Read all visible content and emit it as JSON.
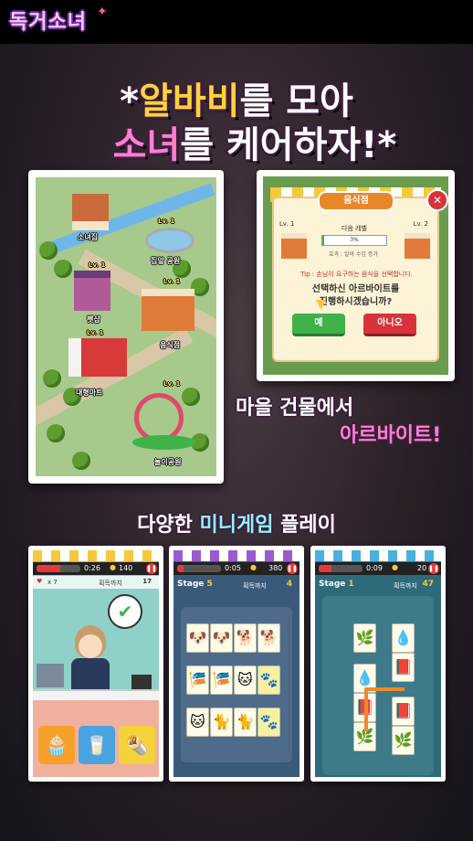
{
  "app": {
    "logo": "독거소녀"
  },
  "headline": {
    "line1_prefix": "*",
    "line1_highlight": "알바비",
    "line1_rest": "를 모아",
    "line2_highlight": "소녀",
    "line2_rest": "를 케어하자!*"
  },
  "map": {
    "labels": {
      "house": "소녀집",
      "park": "집앞 공원",
      "petshop": "펫샵",
      "restaurant": "음식점",
      "mart": "대형마트",
      "amusement": "놀이공원"
    },
    "level": "Lv. 1"
  },
  "shop_dialog": {
    "title": "음식점",
    "lv_left": "Lv. 1",
    "lv_right": "Lv. 2",
    "next_level_label": "다음 레벨",
    "progress_text": "3%",
    "progress_value": 0.03,
    "effect_text": "효과 : 알바 수입 증가",
    "tip": "Tip : 손님이 요구하는 음식을 선택합니다.",
    "question_line1": "선택하신 아르바이트를",
    "question_line2": "진행하시겠습니까?",
    "yes_label": "예",
    "no_label": "아니오"
  },
  "caption": {
    "line1": "마을 건물에서",
    "line2": "아르바이트!"
  },
  "minigame_title": {
    "prefix": "다양한 ",
    "highlight": "미니게임",
    "suffix": " 플레이"
  },
  "minigames": [
    {
      "time": "0:26",
      "score": "140",
      "target_label": "획득까지",
      "count": "17",
      "lives": "x 7"
    },
    {
      "time": "0:05",
      "score": "380",
      "stage_label": "Stage",
      "stage": "5",
      "target_label": "획득까지",
      "count": "4"
    },
    {
      "time": "0:09",
      "score": "20",
      "stage_label": "Stage",
      "stage": "1",
      "target_label": "획득까지",
      "count": "47"
    }
  ],
  "colors": {
    "accent_yellow": "#ffd23a",
    "accent_pink": "#ff7fd0",
    "accent_cyan": "#8ff3ff",
    "yes_green": "#3fb24a",
    "no_red": "#d9323a"
  }
}
